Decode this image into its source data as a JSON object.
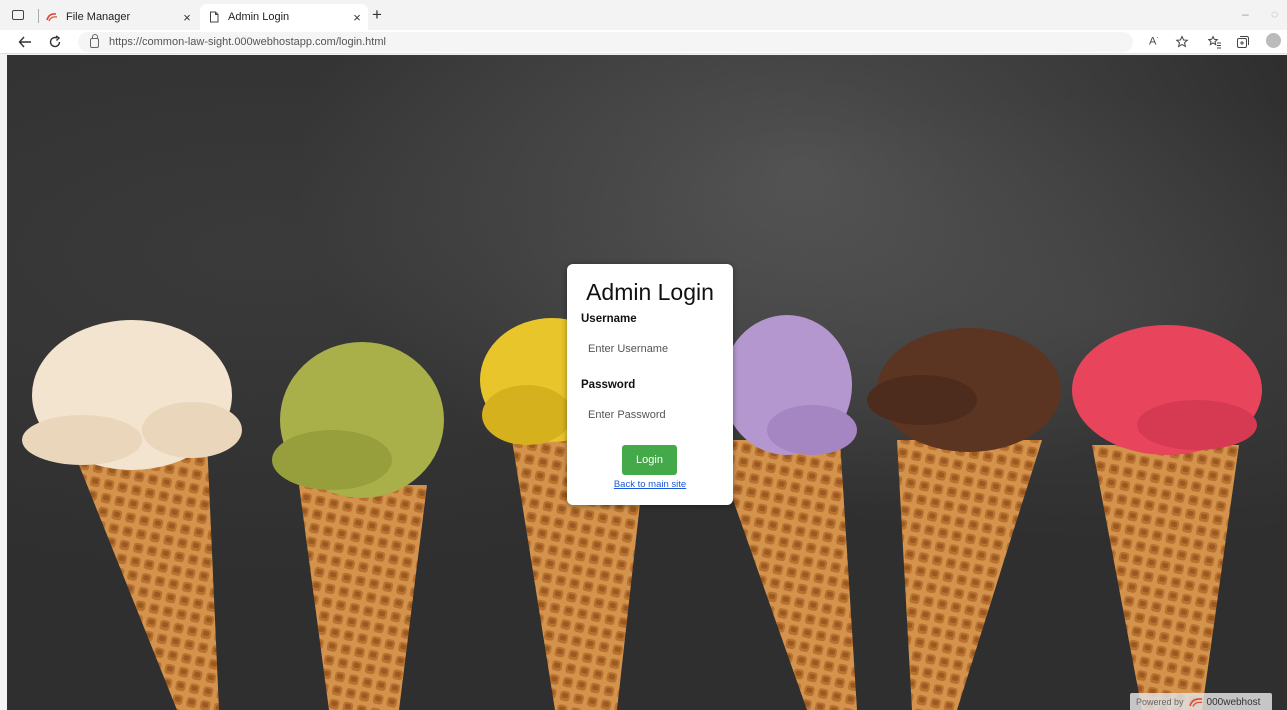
{
  "browser": {
    "tabs": [
      {
        "title": "File Manager",
        "close": "×"
      },
      {
        "title": "Admin Login",
        "close": "×"
      }
    ],
    "new_tab": "+",
    "url": "https://common-law-sight.000webhostapp.com/login.html"
  },
  "login": {
    "title": "Admin Login",
    "username_label": "Username",
    "username_placeholder": "Enter Username",
    "password_label": "Password",
    "password_placeholder": "Enter Password",
    "submit_label": "Login",
    "back_link": "Back to main site"
  },
  "footer_badge": {
    "prefix": "Powered by",
    "brand": "000webhost"
  },
  "colors": {
    "login_button": "#44a948",
    "link": "#1a5ad6",
    "background": "#2f2f2f"
  }
}
